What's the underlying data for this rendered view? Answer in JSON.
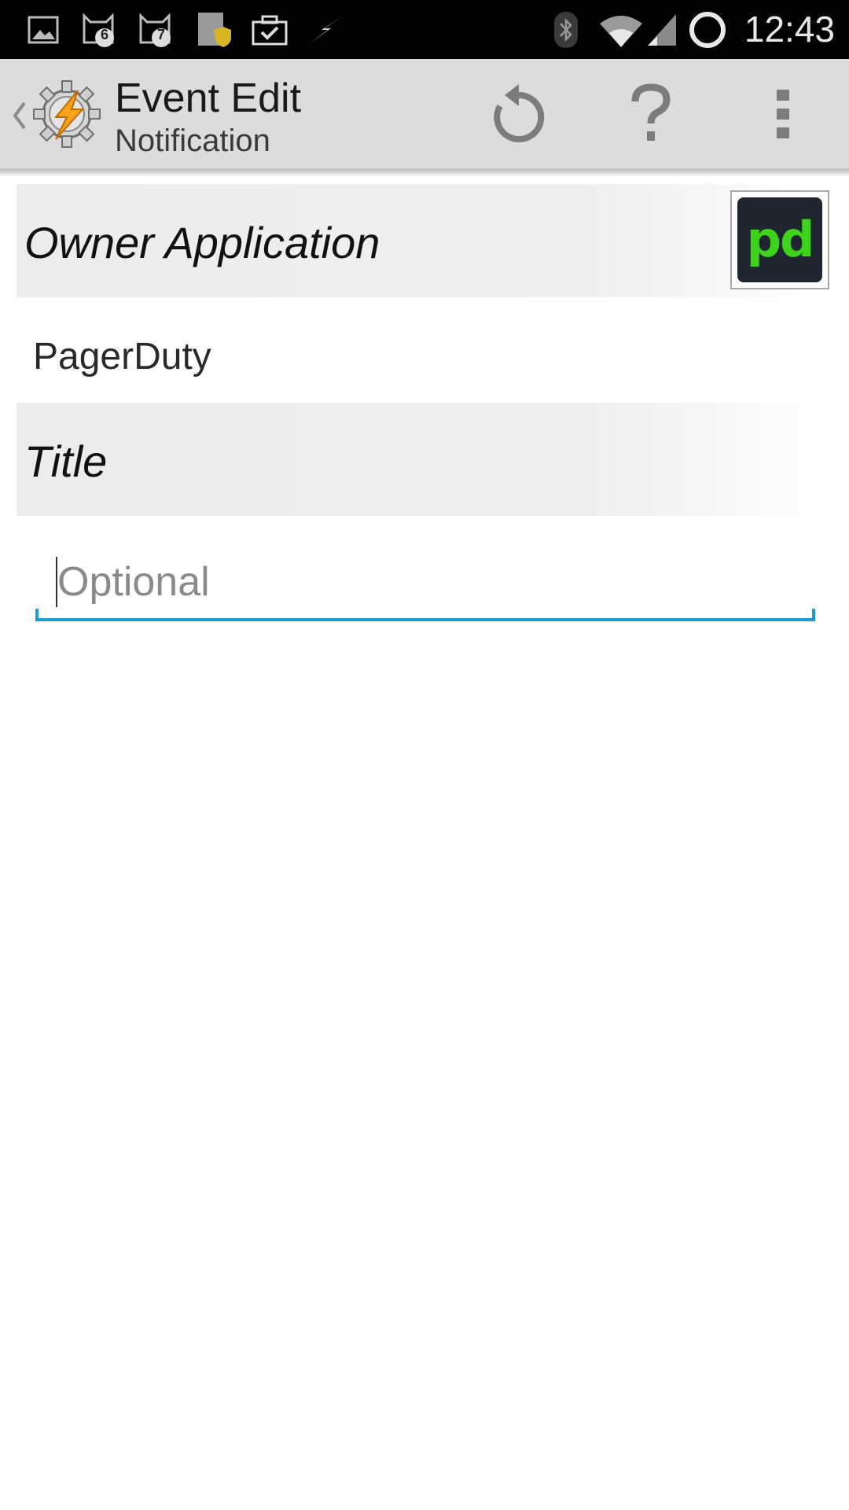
{
  "status_bar": {
    "time": "12:43",
    "notification_icons": [
      "gallery-icon",
      "cat-badge-6-icon",
      "cat-badge-7-icon",
      "secure-doc-icon",
      "briefcase-check-icon",
      "tasker-bolt-icon"
    ],
    "badge_counts": [
      "6",
      "7"
    ],
    "system_icons": [
      "bluetooth-icon",
      "wifi-icon",
      "cell-signal-icon",
      "sync-circle-icon"
    ]
  },
  "action_bar": {
    "title": "Event Edit",
    "subtitle": "Notification",
    "actions": [
      "undo-icon",
      "help-icon",
      "overflow-menu-icon"
    ]
  },
  "owner_application": {
    "label": "Owner Application",
    "value": "PagerDuty",
    "icon_text": "pd",
    "icon_colors": {
      "background": "#1f2630",
      "text": "#3fd21c"
    }
  },
  "title_field": {
    "label": "Title",
    "value": "",
    "placeholder": "Optional"
  },
  "colors": {
    "accent": "#1a9ad6",
    "action_bar": "#dcdcdc",
    "status_bar": "#000000"
  }
}
